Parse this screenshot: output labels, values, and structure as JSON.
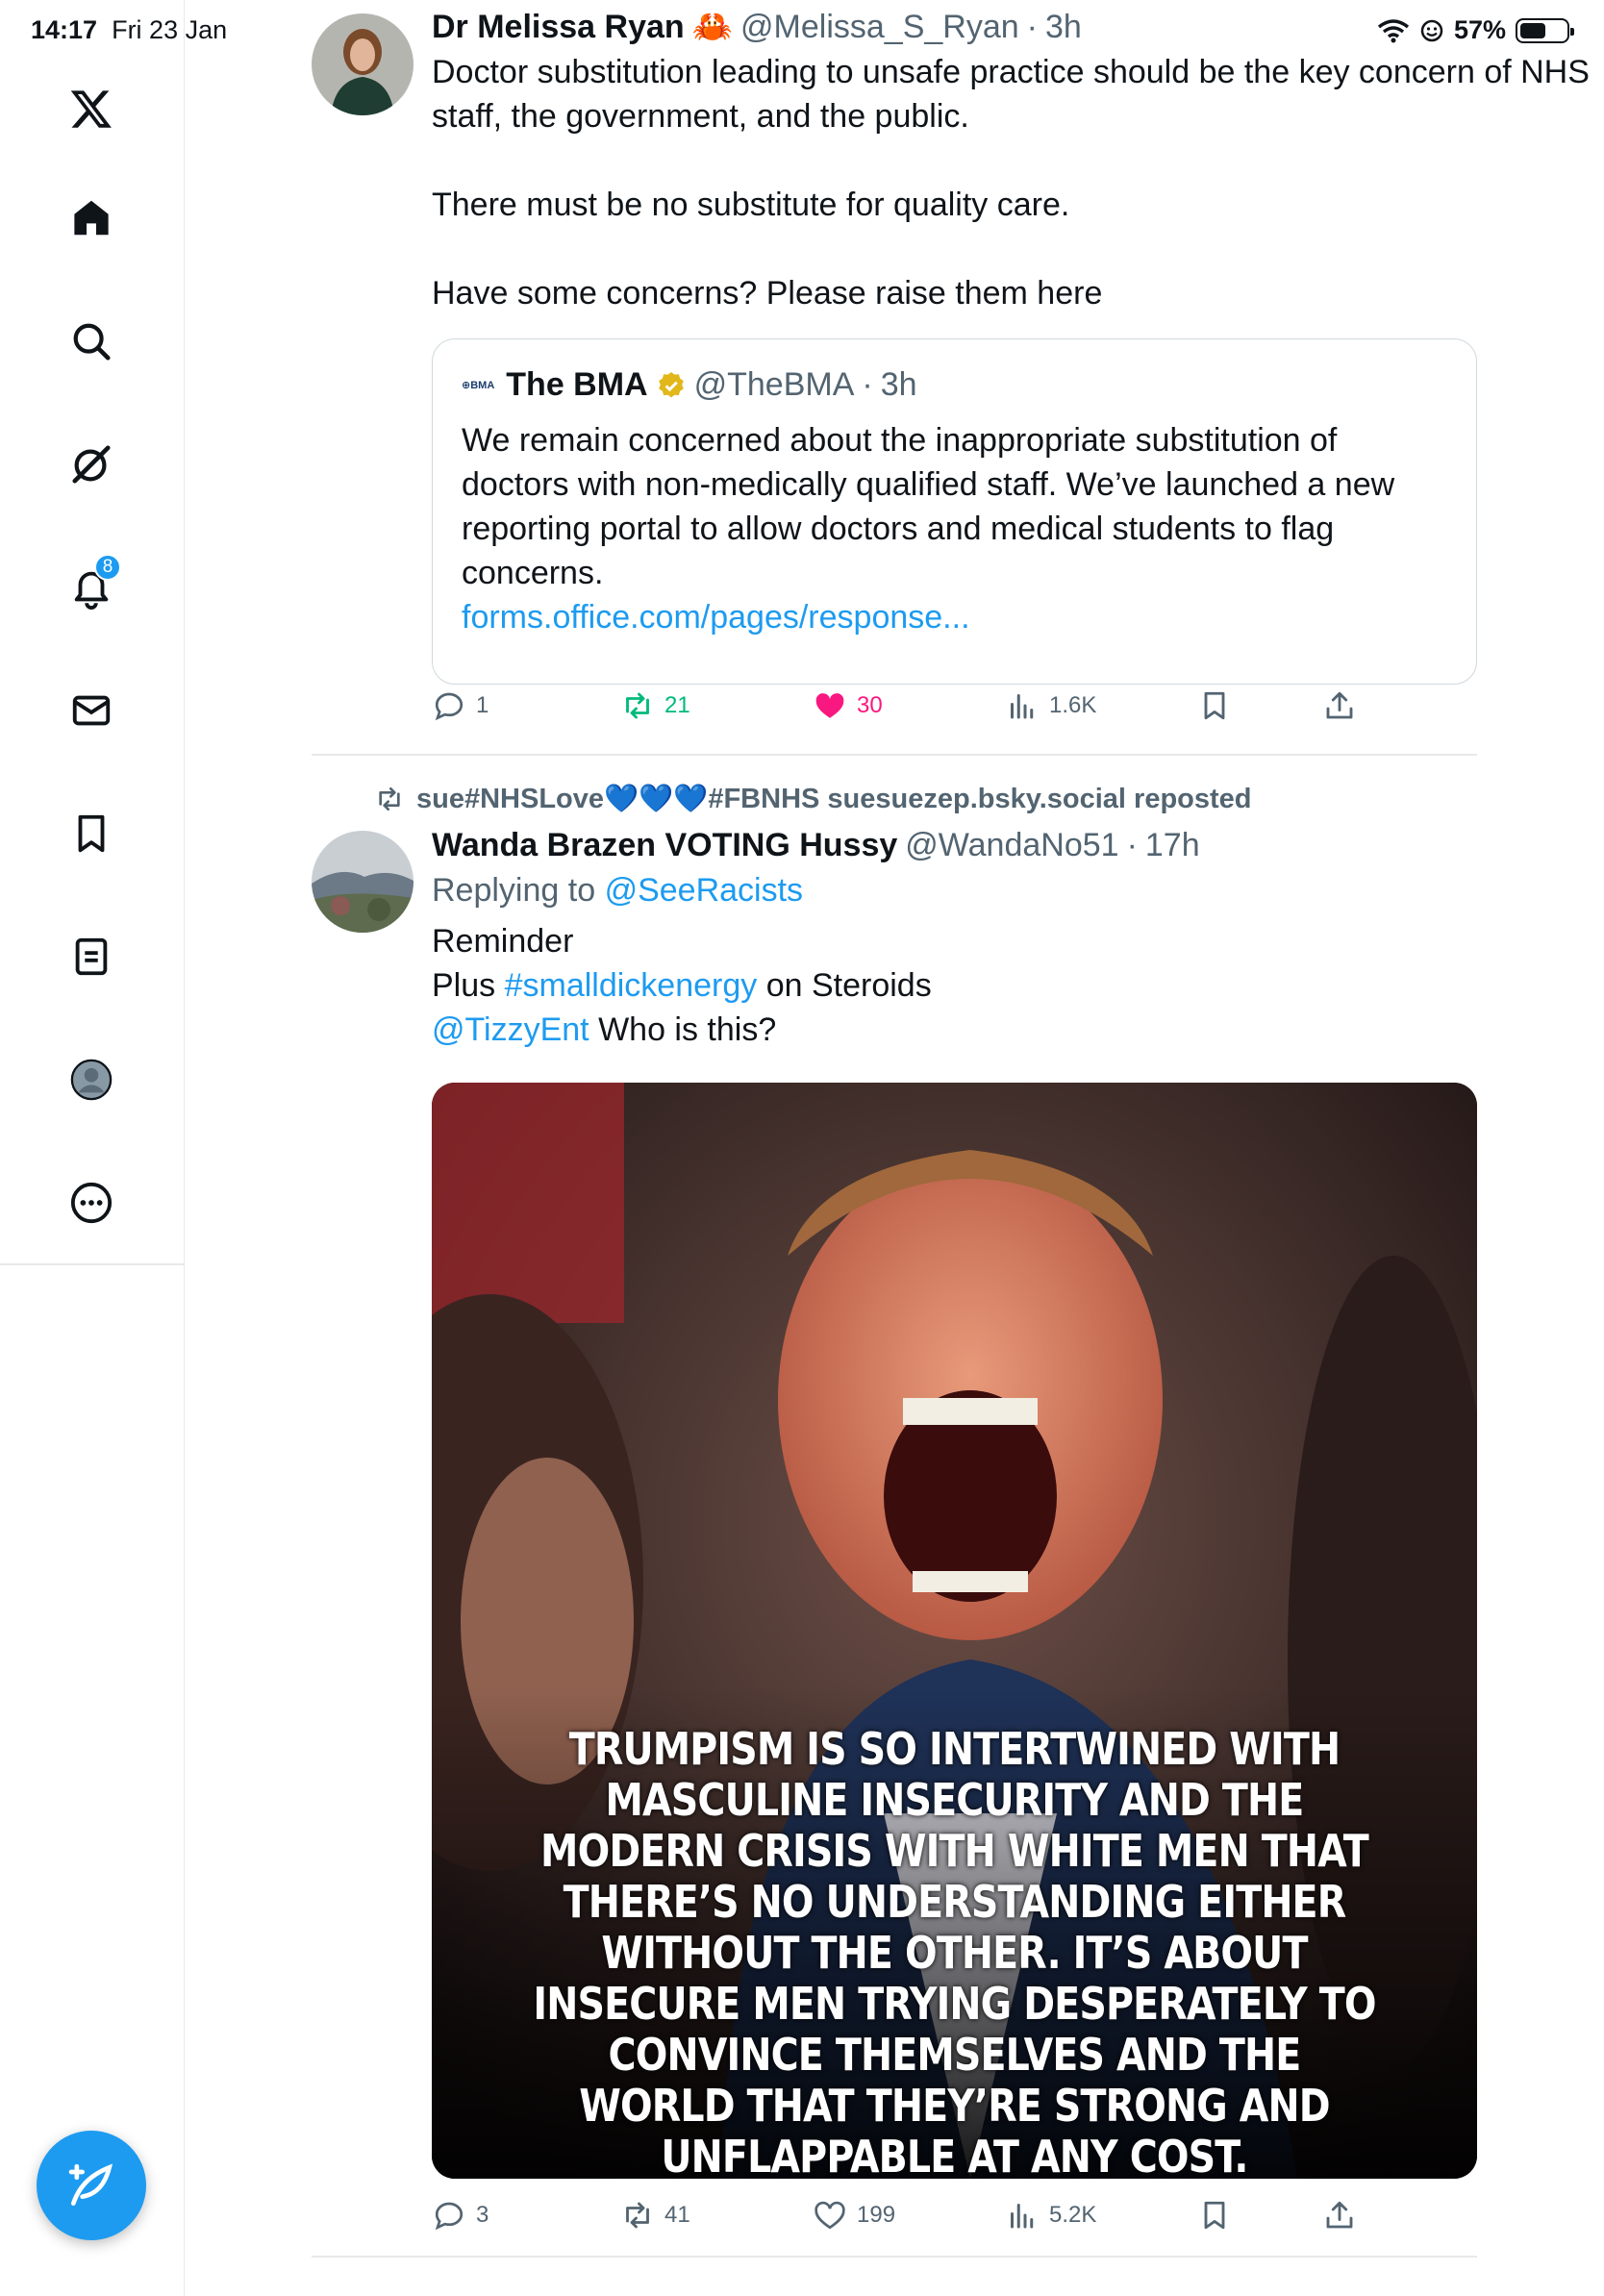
{
  "status_bar": {
    "time": "14:17",
    "date": "Fri 23 Jan",
    "battery": "57%"
  },
  "sidebar": {
    "notifications_badge": "8"
  },
  "tweet1": {
    "name": "Dr Melissa Ryan",
    "name_emoji": "🦀",
    "handle": "@Melissa_S_Ryan",
    "time": "3h",
    "text": "Doctor substitution leading to unsafe practice should be the key concern of NHS staff, the government, and the public.\n\nThere must be no substitute for quality care.\n\nHave some concerns? Please raise them here",
    "quote": {
      "logo": "⊕BMA",
      "name": "The BMA",
      "handle": "@TheBMA",
      "time": "3h",
      "text": "We remain concerned about the inappropriate substitution of doctors with non-medically qualified staff. We’ve launched a new reporting portal to allow doctors and medical students to flag concerns.",
      "link": "forms.office.com/pages/response..."
    },
    "replies": "1",
    "reposts": "21",
    "likes": "30",
    "views": "1.6K"
  },
  "tweet2": {
    "repost_label": "sue#NHSLove💙💙💙#FBNHS suesuezep.bsky.social reposted",
    "name": "Wanda Brazen VOTING Hussy",
    "handle": "@WandaNo51",
    "time": "17h",
    "replying_prefix": "Replying to",
    "replying_to": "@SeeRacists",
    "line1": "Reminder",
    "line2_prefix": "Plus",
    "hashtag": "#smalldickenergy",
    "line2_suffix": "on Steroids",
    "mention": "@TizzyEnt",
    "line3_suffix": "Who is this?",
    "image_text": "TRUMPISM IS SO INTERTWINED WITH MASCULINE INSECURITY AND THE MODERN CRISIS WITH WHITE MEN THAT THERE’S NO UNDERSTANDING EITHER WITHOUT THE OTHER. IT’S ABOUT INSECURE MEN TRYING DESPERATELY TO CONVINCE THEMSELVES AND THE WORLD THAT THEY’RE STRONG AND UNFLAPPABLE AT ANY COST.",
    "replies": "3",
    "reposts": "41",
    "likes": "199",
    "views": "5.2K"
  },
  "colors": {
    "accent": "#1d9bf0",
    "repost": "#00ba7c",
    "like": "#f91880",
    "muted": "#536471"
  }
}
